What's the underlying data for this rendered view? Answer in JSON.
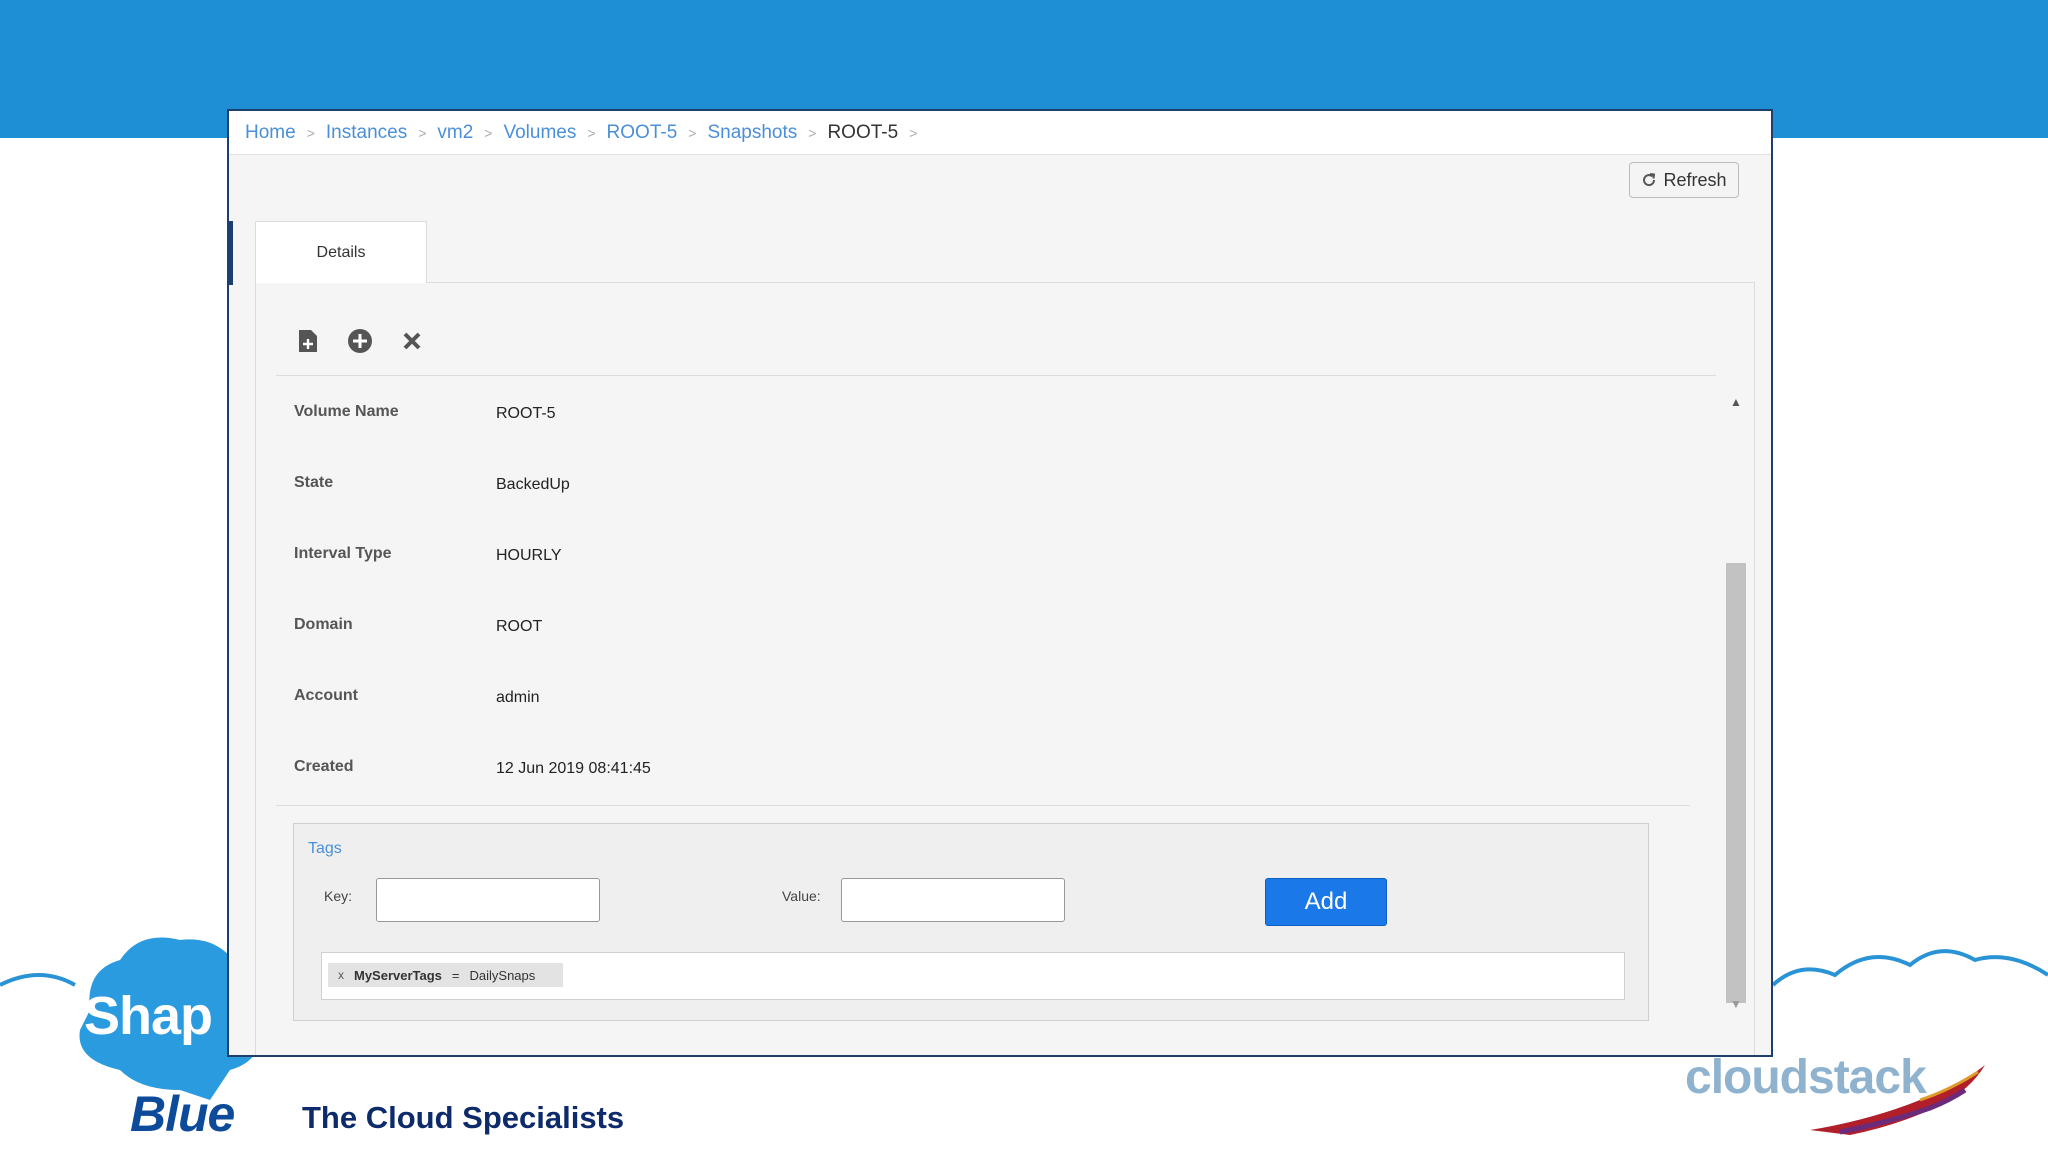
{
  "breadcrumb": {
    "items": [
      "Home",
      "Instances",
      "vm2",
      "Volumes",
      "ROOT-5",
      "Snapshots"
    ],
    "current": "ROOT-5",
    "separator": ">"
  },
  "toolbar": {
    "refresh_label": "Refresh"
  },
  "tabs": [
    {
      "label": "Details"
    }
  ],
  "details": {
    "rows": [
      {
        "label": "Volume Name",
        "value": "ROOT-5"
      },
      {
        "label": "State",
        "value": "BackedUp"
      },
      {
        "label": "Interval Type",
        "value": "HOURLY"
      },
      {
        "label": "Domain",
        "value": "ROOT"
      },
      {
        "label": "Account",
        "value": "admin"
      },
      {
        "label": "Created",
        "value": "12 Jun 2019 08:41:45"
      }
    ]
  },
  "actions": [
    {
      "icon": "create-template-icon"
    },
    {
      "icon": "add-circle-icon"
    },
    {
      "icon": "delete-icon"
    }
  ],
  "tags": {
    "title": "Tags",
    "key_label": "Key:",
    "value_label": "Value:",
    "key_value": "",
    "value_value": "",
    "add_label": "Add",
    "items": [
      {
        "remove": "x",
        "key": "MyServerTags",
        "eq": "=",
        "value": "DailySnaps"
      }
    ]
  },
  "branding": {
    "company_word1": "Shap",
    "company_word2": "Blue",
    "tagline": "The Cloud Specialists",
    "product_logo": "cloudstack"
  },
  "colors": {
    "band": "#1e8fd5",
    "frame": "#1c3f6e",
    "link": "#4a8fd8",
    "add_button": "#1a78e8"
  }
}
